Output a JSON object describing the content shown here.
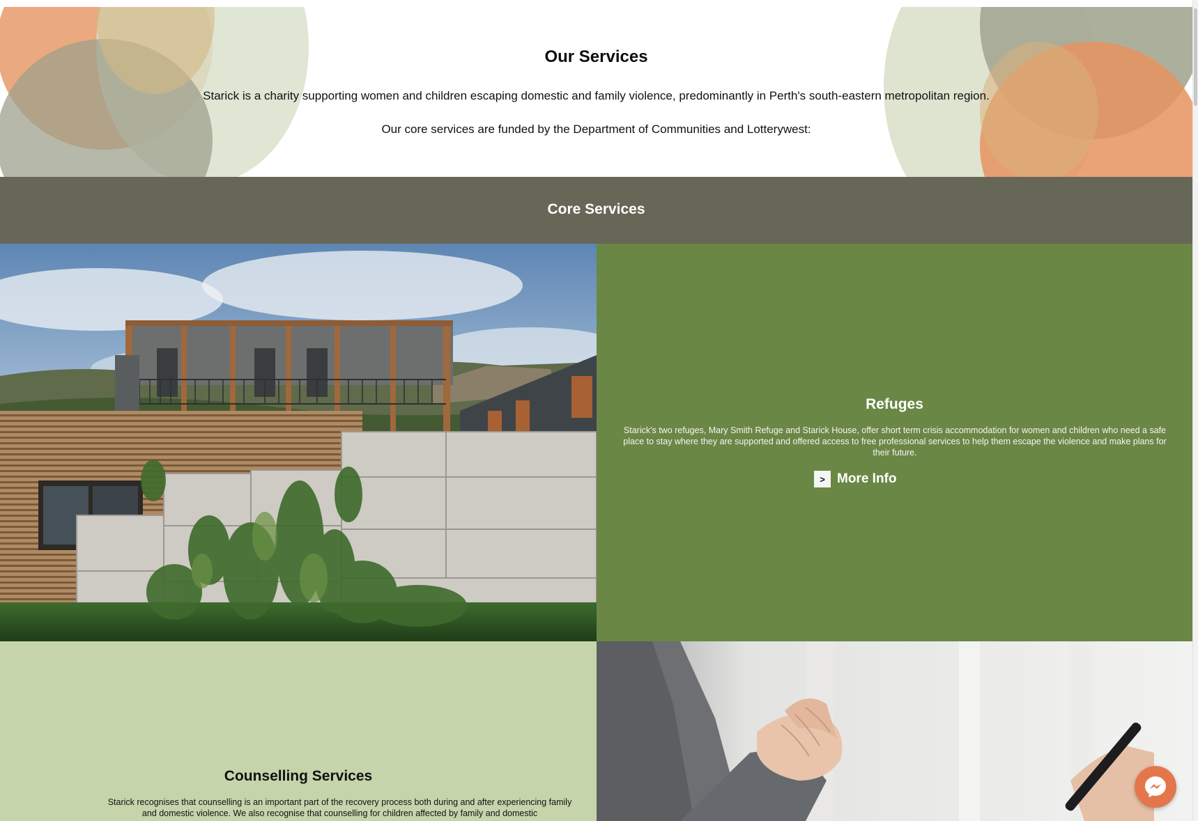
{
  "hero": {
    "title": "Our Services",
    "intro": "Starick is a charity supporting women and children escaping domestic and family violence, predominantly in Perth's south-eastern metropolitan region.",
    "funding": "Our core services are funded by the Department of Communities and Lotterywest:"
  },
  "core": {
    "title": "Core Services"
  },
  "refuges": {
    "title": "Refuges",
    "description": "Starick's two refuges, Mary Smith Refuge and Starick House, offer short term crisis accommodation for women and children who need a safe place to stay where they are supported and offered access to free professional services to help them escape the violence and make plans for their future.",
    "more_chevron": ">",
    "more_label": "More Info"
  },
  "counselling": {
    "title": "Counselling Services",
    "description": "Starick recognises that counselling is an important part of the recovery process both during and after experiencing family and domestic violence. We also recognise that counselling for children affected by family and domestic"
  },
  "colors": {
    "core_band": "#676757",
    "refuges_bg": "#6a8745",
    "counselling_bg": "#c6d4ac",
    "accent_orange": "#e4764c"
  },
  "icons": {
    "messenger": "messenger-icon",
    "more_info": "chevron-right-icon"
  }
}
